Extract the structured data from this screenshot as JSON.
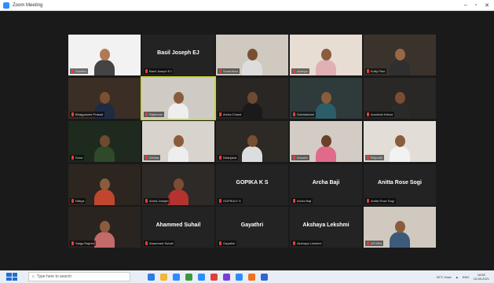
{
  "window": {
    "title": "Zoom Meeting"
  },
  "participants": [
    {
      "name": "Sunitha",
      "show_name": false,
      "video": true,
      "bg": "#f2f2f2",
      "skin": "#b07a55",
      "shirt": "#444"
    },
    {
      "name": "Basil Joseph EJ",
      "show_name": true,
      "video": false
    },
    {
      "name": "Sunanthini",
      "show_name": false,
      "video": true,
      "bg": "#cfc9c0",
      "skin": "#7a5034",
      "shirt": "#ddd"
    },
    {
      "name": "Ananya",
      "show_name": false,
      "video": true,
      "bg": "#e8ddd3",
      "skin": "#8a5c3c",
      "shirt": "#e0b0b5"
    },
    {
      "name": "Kutty Pavi",
      "show_name": false,
      "video": true,
      "bg": "#3a332c",
      "skin": "#9a6845",
      "shirt": "#2f2f2f"
    },
    {
      "name": "Bhagyasree Prasad",
      "show_name": false,
      "video": true,
      "bg": "#3b2f25",
      "skin": "#7b4f32",
      "shirt": "#1f2b44"
    },
    {
      "name": "Rajeevan",
      "show_name": false,
      "video": true,
      "active": true,
      "bg": "#cfcbc4",
      "skin": "#8a5c3c",
      "shirt": "#eeeeee"
    },
    {
      "name": "Archa Chand",
      "show_name": false,
      "video": true,
      "bg": "#2a2624",
      "skin": "#6e4a33",
      "shirt": "#1a1a1a"
    },
    {
      "name": "Sreelakshmi",
      "show_name": false,
      "video": true,
      "bg": "#2f3a3b",
      "skin": "#8a5c3c",
      "shirt": "#2c5e6a"
    },
    {
      "name": "Anushah Kishor",
      "show_name": false,
      "video": true,
      "bg": "#2a2826",
      "skin": "#7a4e32",
      "shirt": "#2a2a2a"
    },
    {
      "name": "Sona",
      "show_name": false,
      "video": true,
      "bg": "#1e2a1e",
      "skin": "#6f4a30",
      "shirt": "#2f4a2a"
    },
    {
      "name": "Devika",
      "show_name": false,
      "video": true,
      "bg": "#d8d3cc",
      "skin": "#8a5c3c",
      "shirt": "#eeeeee"
    },
    {
      "name": "Niranjana",
      "show_name": false,
      "video": true,
      "bg": "#2d2a26",
      "skin": "#7a4e32",
      "shirt": "#dddddd"
    },
    {
      "name": "Anusha",
      "show_name": false,
      "video": true,
      "bg": "#d2ccc4",
      "skin": "#6a4028",
      "shirt": "#e06a8a"
    },
    {
      "name": "Rejrudhi",
      "show_name": false,
      "video": true,
      "bg": "#e2ddd6",
      "skin": "#8a5c3c",
      "shirt": "#f2f2f2"
    },
    {
      "name": "Nithya",
      "show_name": false,
      "video": true,
      "bg": "#2c2520",
      "skin": "#8a5c3c",
      "shirt": "#c2452f"
    },
    {
      "name": "Archa Joseph",
      "show_name": false,
      "video": true,
      "bg": "#2e2a28",
      "skin": "#7a4e32",
      "shirt": "#b5332e"
    },
    {
      "name": "GOPIKA K S",
      "show_name": true,
      "video": false
    },
    {
      "name": "Archa Baji",
      "show_name": true,
      "video": false
    },
    {
      "name": "Anitta Rose Sogi",
      "show_name": true,
      "video": false
    },
    {
      "name": "Saiga Rajesh",
      "show_name": false,
      "video": true,
      "bg": "#2a2420",
      "skin": "#8a5c3c",
      "shirt": "#c46a6a"
    },
    {
      "name": "Ahammed Suhail",
      "show_name": true,
      "video": false
    },
    {
      "name": "Gayathri",
      "show_name": true,
      "video": false
    },
    {
      "name": "Akshaya Lekshmi",
      "show_name": true,
      "video": false
    },
    {
      "name": "ATHIRA",
      "show_name": false,
      "video": true,
      "bg": "#cfc9c0",
      "skin": "#8a5c3c",
      "shirt": "#3c5a7a"
    }
  ],
  "taskbar": {
    "search_placeholder": "Type here to search",
    "apps": [
      "#2d7be5",
      "#f2b733",
      "#2d8cff",
      "#3a9a3a",
      "#2d8cff",
      "#e0413a",
      "#7a3fd8",
      "#2d8cff",
      "#f07020",
      "#3366cc"
    ],
    "weather": "30°C Haze",
    "language": "ENG",
    "time": "18:58",
    "date": "15-08-2021"
  }
}
